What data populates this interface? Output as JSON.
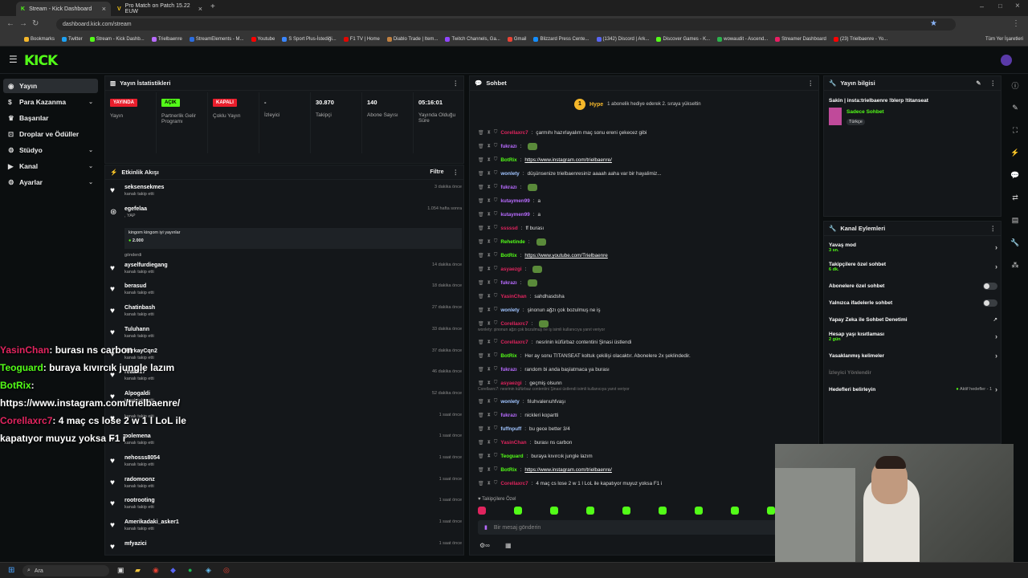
{
  "browser": {
    "tabs": [
      {
        "title": "Stream - Kick Dashboard",
        "active": true
      },
      {
        "title": "Pro Match on Patch 15.22 EUW",
        "active": false
      }
    ],
    "url": "dashboard.kick.com/stream",
    "bookmarks": [
      "Bookmarks",
      "Twitter",
      "Stream - Kick Dashb...",
      "Trielbaenre",
      "StreamElements - M...",
      "Youtube",
      "S Sport Plus-İstediği...",
      "F1 TV | Home",
      "Diablo Trade | Item...",
      "Twitch Channels, Ga...",
      "Gmail",
      "Blizzard Press Cente...",
      "(1342) Discord | Ark...",
      "Discover Games - K...",
      "wowaudit - Ascend...",
      "Streamer Dashboard",
      "(23) Trielbaenre - Yo..."
    ],
    "all_bookmarks": "Tüm Yer İşaretleri"
  },
  "logo": "KICK",
  "sidebar": [
    {
      "label": "Yayın",
      "icon": "broadcast-icon"
    },
    {
      "label": "Para Kazanma",
      "icon": "money-icon"
    },
    {
      "label": "Başarılar",
      "icon": "trophy-icon"
    },
    {
      "label": "Droplar ve Ödüller",
      "icon": "gift-icon"
    },
    {
      "label": "Stüdyo",
      "icon": "studio-icon"
    },
    {
      "label": "Kanal",
      "icon": "channel-icon"
    },
    {
      "label": "Ayarlar",
      "icon": "gear-icon"
    }
  ],
  "stats": {
    "title": "Yayın İstatistikleri",
    "items": [
      {
        "value": "YAYINDA",
        "label": "Yayın",
        "color": "#e91e2c"
      },
      {
        "value": "AÇIK",
        "label": "Partnerlik Gelir Programı",
        "color": "#53fc18"
      },
      {
        "value": "KAPALI",
        "label": "Çoklu Yayın",
        "color": "#e91e2c"
      },
      {
        "value": "-",
        "label": "İzleyici"
      },
      {
        "value": "30.870",
        "label": "Takipçi"
      },
      {
        "value": "140",
        "label": "Abone Sayısı"
      },
      {
        "value": "05:16:01",
        "label": "Yayında Olduğu Süre"
      }
    ]
  },
  "activity": {
    "title": "Etkinlik Akışı",
    "filter": "Filtre",
    "items": [
      {
        "name": "seksensekmes",
        "sub": "kanalı takip etti",
        "time": "3 dakika önce"
      },
      {
        "name": "egefelaa",
        "sub": ", YAP",
        "time": "1.054 hafta sonra",
        "msg": "kingom kingom iyi yayınlar",
        "amount": "2.000",
        "sent": "gönderdi"
      },
      {
        "name": "ayselfurdiegang",
        "sub": "kanalı takip etti",
        "time": "14 dakika önce"
      },
      {
        "name": "berasud",
        "sub": "kanalı takip etti",
        "time": "18 dakika önce"
      },
      {
        "name": "Chatinbash",
        "sub": "kanalı takip etti",
        "time": "27 dakika önce"
      },
      {
        "name": "Tuluhann",
        "sub": "kanalı takip etti",
        "time": "33 dakika önce"
      },
      {
        "name": "BerkayCqn2",
        "sub": "kanalı takip etti",
        "time": "37 dakika önce"
      },
      {
        "name": "reaaa17",
        "sub": "kanalı takip etti",
        "time": "46 dakika önce"
      },
      {
        "name": "Alpogaldi",
        "sub": "kanalı takip etti",
        "time": "52 dakika önce"
      },
      {
        "name": "",
        "sub": "kanalı takip etti",
        "time": "1 saat önce"
      },
      {
        "name": "polemena",
        "sub": "kanalı takip etti",
        "time": "1 saat önce"
      },
      {
        "name": "nehosss8054",
        "sub": "kanalı takip etti",
        "time": "1 saat önce"
      },
      {
        "name": "radomoonz",
        "sub": "kanalı takip etti",
        "time": "1 saat önce"
      },
      {
        "name": "rootrooting",
        "sub": "kanalı takip etti",
        "time": "1 saat önce"
      },
      {
        "name": "Amerikadaki_asker1",
        "sub": "kanalı takip etti",
        "time": "1 saat önce"
      },
      {
        "name": "mfyazici",
        "sub": "",
        "time": "1 saat önce"
      }
    ]
  },
  "chat": {
    "title": "Sohbet",
    "hype": {
      "label": "Hype",
      "level": "1",
      "text": "1 abonelik hediye ederek 2. sıraya yükseltin"
    },
    "messages": [
      {
        "user": "Corellaxrc7",
        "color": "#e0245e",
        "text": "çarmıhı hazırlayalım maç sonu ereni çekecez gibi"
      },
      {
        "user": "fukrazı",
        "color": "#b86bff",
        "text": "",
        "emote": true
      },
      {
        "user": "BotRix",
        "color": "#53fc18",
        "text": "https://www.instagram.com/trielbaenre/",
        "link": true
      },
      {
        "user": "wonlety",
        "color": "#a0c4ff",
        "text": "düşünsenize trielbaenresiniz aaaah aaha var bir hayalimiz..."
      },
      {
        "user": "fukrazı",
        "color": "#b86bff",
        "text": "",
        "emote": true
      },
      {
        "user": "kutaymen99",
        "color": "#b86bff",
        "text": "a"
      },
      {
        "user": "kutaymen99",
        "color": "#b86bff",
        "text": "a"
      },
      {
        "user": "sssssd",
        "color": "#e0245e",
        "text": "ff burası"
      },
      {
        "user": "Rehetinde",
        "color": "#53fc18",
        "text": "",
        "emote": true
      },
      {
        "user": "BotRix",
        "color": "#53fc18",
        "text": "https://www.youtube.com/Trielbaenre",
        "link": true
      },
      {
        "user": "asyaezgi",
        "color": "#e0245e",
        "text": "",
        "emote": true
      },
      {
        "user": "fukrazı",
        "color": "#b86bff",
        "text": "",
        "emote": true
      },
      {
        "user": "YasinChan",
        "color": "#e0245e",
        "text": "sahdhasdsha"
      },
      {
        "user": "wonlety",
        "color": "#a0c4ff",
        "text": "şinonun ağzı çok bozulmuş ne iş"
      },
      {
        "user": "Corellaxrc7",
        "color": "#e0245e",
        "text": "",
        "emote": true
      },
      {
        "user": "Corellaxrc7",
        "color": "#e0245e",
        "text": "nesrinin küfürbaz contentini Şinasi üstlendi",
        "reply": "wonlety: şinonun ağzı çok bozulmuş ne iş isimli kullanıcıya yanıt veriyor"
      },
      {
        "user": "BotRix",
        "color": "#53fc18",
        "text": "Her ay sonu TITANSEAT koltuk çekilişi olacaktır. Abonelere 2x şeklindedir."
      },
      {
        "user": "fukrazı",
        "color": "#b86bff",
        "text": "random bi anda başlatmaca ya burası"
      },
      {
        "user": "asyaezgi",
        "color": "#e0245e",
        "text": "geçmiş olsunn"
      },
      {
        "user": "wonlety",
        "color": "#a0c4ff",
        "text": "fıluhvalerıuhfvaşı",
        "reply": "Corellaxrc7: nesrinin küfürbaz contentini Şinasi üstlendi isimli kullanıcıya yanıt veriyor"
      },
      {
        "user": "fukrazı",
        "color": "#b86bff",
        "text": "nickleri kopartti"
      },
      {
        "user": "fuffnpuff",
        "color": "#a0c4ff",
        "text": "bu gece better 3/4"
      },
      {
        "user": "YasinChan",
        "color": "#e0245e",
        "text": "burası ns carbon"
      },
      {
        "user": "Teoguard",
        "color": "#53fc18",
        "text": "buraya kıvırcık jungle lazım"
      },
      {
        "user": "BotRix",
        "color": "#53fc18",
        "text": "https://www.instagram.com/trielbaenre/",
        "link": true
      },
      {
        "user": "Corellaxrc7",
        "color": "#e0245e",
        "text": "4 maç cs lose 2 w 1 l LoL ile kapatıyor muyuz yoksa F1 i"
      }
    ],
    "followers_only": "Takipçilere Özel",
    "placeholder": "Bir mesaj gönderin"
  },
  "stream_info": {
    "title": "Yayın bilgisi",
    "stream_title": "Sakin | insta:trielbaenre !blerp !titanseat",
    "category": "Sadece Sohbet",
    "tag": "Türkçe"
  },
  "channel_actions": {
    "title": "Kanal Eylemleri",
    "items": [
      {
        "label": "Yavaş mod",
        "sub": "3 sn.",
        "type": "arrow"
      },
      {
        "label": "Takipçilere özel sohbet",
        "sub": "6 dk.",
        "type": "arrow"
      },
      {
        "label": "Abonelere özel sohbet",
        "sub": "",
        "type": "toggle"
      },
      {
        "label": "Yalnızca ifadelerle sohbet",
        "sub": "",
        "type": "toggle"
      },
      {
        "label": "Yapay Zeka ile Sohbet Denetimi",
        "sub": "",
        "type": "external"
      },
      {
        "label": "Hesap yaşı kısıtlaması",
        "sub": "2 gün",
        "type": "arrow"
      },
      {
        "label": "Yasaklanmış kelimeler",
        "sub": "",
        "type": "arrow"
      },
      {
        "label": "İzleyici Yönlendir",
        "sub": "",
        "type": "disabled"
      },
      {
        "label": "Hedefleri belirleyin",
        "sub": "",
        "type": "goal",
        "extra": "Aktif hedefler - 1"
      }
    ]
  },
  "overlay": [
    {
      "user": "YasinChan",
      "text": ": burası ns carbon",
      "color": "#e0245e"
    },
    {
      "user": "Teoguard",
      "text": ": buraya kıvırcık jungle lazım",
      "color": "#53fc18"
    },
    {
      "user": "BotRix",
      "text": ":",
      "color": "#53fc18"
    },
    {
      "user": "",
      "text": "https://www.instagram.com/trielbaenre/",
      "color": "#fff"
    },
    {
      "user": "Corellaxrc7",
      "text": ": 4 maç cs lose 2 w 1 l LoL ile",
      "color": "#e0245e"
    },
    {
      "user": "",
      "text": "kapatıyor muyuz yoksa F1 i",
      "color": "#fff"
    }
  ],
  "taskbar": {
    "search": "Ara"
  },
  "colors": {
    "accent": "#53fc18",
    "live": "#e91e2c",
    "panel": "#14171a"
  }
}
